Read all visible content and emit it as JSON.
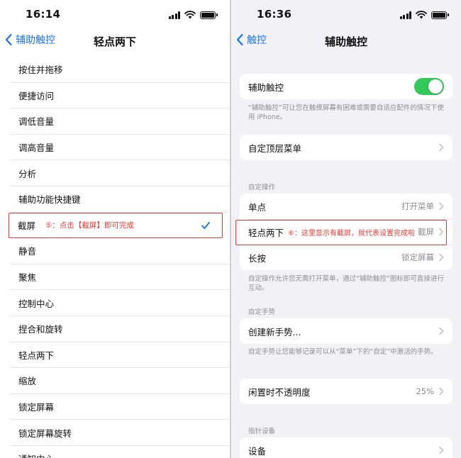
{
  "left": {
    "time": "16:14",
    "nav": {
      "back_label": "辅助触控",
      "title": "轻点两下"
    },
    "items": [
      "按住并拖移",
      "便捷访问",
      "调低音量",
      "调高音量",
      "分析",
      "辅助功能快捷键",
      "截屏",
      "静音",
      "聚焦",
      "控制中心",
      "捏合和旋转",
      "轻点两下",
      "缩放",
      "锁定屏幕",
      "锁定屏幕旋转",
      "通知中心"
    ],
    "selected_item": "截屏",
    "annotation": "⑤：点击【截屏】即可完成"
  },
  "right": {
    "time": "16:36",
    "nav": {
      "back_label": "触控",
      "title": "辅助触控"
    },
    "assistive_touch": {
      "label": "辅助触控",
      "enabled": true,
      "note": "“辅助触控”可让您在触摸屏幕有困难或需要自适应配件的情况下使用 iPhone。"
    },
    "top_menu": {
      "label": "自定顶层菜单"
    },
    "custom_actions": {
      "header": "自定操作",
      "single_tap": {
        "label": "单点",
        "value": "打开菜单"
      },
      "double_tap": {
        "label": "轻点两下",
        "value": "截屏",
        "annotation": "⑥：这里显示有截屏，就代表设置完成啦"
      },
      "long_press": {
        "label": "长按",
        "value": "锁定屏幕"
      },
      "note": "自定操作允许您无需打开菜单，通过“辅助触控”图标即可直接进行互动。"
    },
    "custom_gestures": {
      "header": "自定手势",
      "create": {
        "label": "创建新手势..."
      },
      "note": "自定手势让您能够记录可以从“菜单”下的“自定”中激活的手势。"
    },
    "idle_opacity": {
      "label": "闲置时不透明度",
      "value": "25%"
    },
    "pointer_devices": {
      "header": "指针设备",
      "devices": {
        "label": "设备"
      }
    }
  },
  "colors": {
    "accent": "#1a73e8",
    "toggle_on": "#34c759",
    "annotation": "#e53935"
  }
}
